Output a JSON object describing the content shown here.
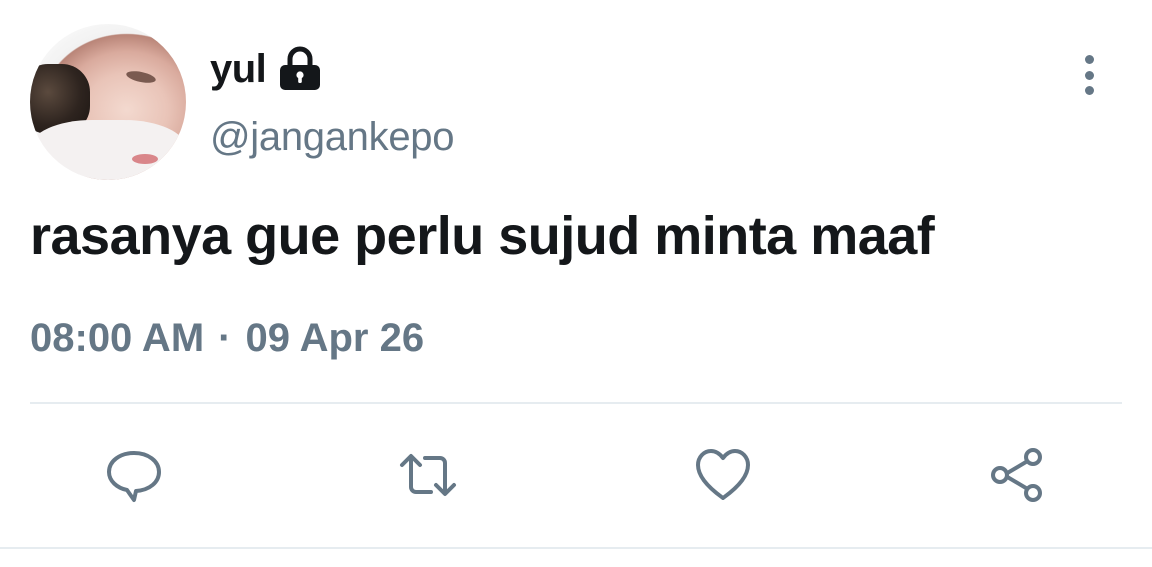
{
  "user": {
    "display_name": "yul",
    "handle": "@jangankepo",
    "protected_icon": "lock-icon"
  },
  "tweet": {
    "text": "rasanya gue perlu sujud minta maaf",
    "time": "08:00 AM",
    "separator": "·",
    "date": "09 Apr 26"
  },
  "actions": [
    {
      "name": "reply",
      "icon": "speech-bubble-icon"
    },
    {
      "name": "retweet",
      "icon": "retweet-arrows-icon"
    },
    {
      "name": "like",
      "icon": "heart-icon"
    },
    {
      "name": "share",
      "icon": "share-nodes-icon"
    }
  ],
  "menu": {
    "icon": "vertical-dots-icon"
  },
  "colors": {
    "text_primary": "#14171a",
    "text_secondary": "#657786",
    "divider": "#e6ecf0",
    "background": "#ffffff"
  }
}
